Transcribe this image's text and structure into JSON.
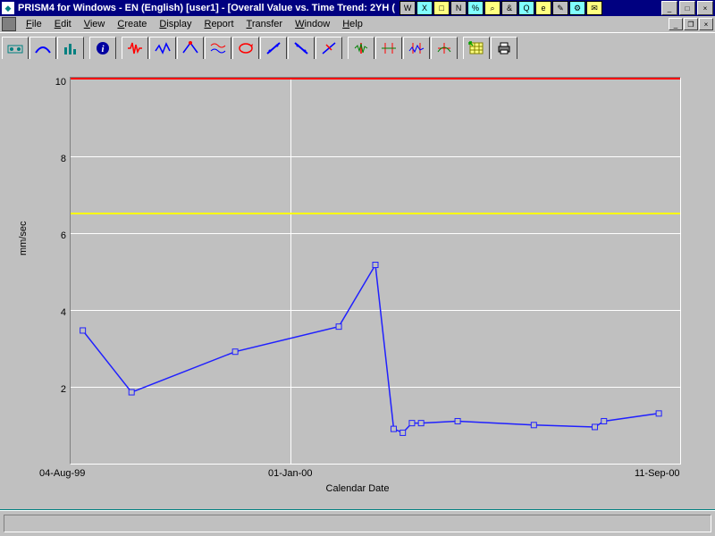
{
  "titlebar": {
    "title": "PRISM4 for Windows - EN (English) [user1] - [Overall Value vs. Time Trend: 2YH (",
    "controls": {
      "min": "_",
      "max": "□",
      "close": "×"
    }
  },
  "tray_icons": [
    "W",
    "X",
    "□",
    "N",
    "%",
    "⌕",
    "&",
    "Q",
    "e",
    "✎",
    "⚙",
    "✉"
  ],
  "menu": {
    "items": [
      "File",
      "Edit",
      "View",
      "Create",
      "Display",
      "Report",
      "Transfer",
      "Window",
      "Help"
    ]
  },
  "toolbar": {
    "items": [
      "machine",
      "sweep",
      "bars",
      "info",
      "wave-red",
      "wave-blue",
      "peak",
      "dual-wave",
      "loop",
      "slash-up",
      "slash-down",
      "slash-x",
      "arrows-1",
      "arrows-2",
      "arrows-3",
      "arrows-4",
      "grid",
      "print"
    ]
  },
  "axes": {
    "ylabel": "mm/sec",
    "xlabel": "Calendar Date",
    "yticks": [
      "2",
      "4",
      "6",
      "8",
      "10"
    ],
    "xticks": {
      "left": "04-Aug-99",
      "mid": "01-Jan-00",
      "right": "11-Sep-00"
    }
  },
  "chart_data": {
    "type": "line",
    "title": "Overall Value vs. Time Trend",
    "xlabel": "Calendar Date",
    "ylabel": "mm/sec",
    "ylim": [
      0,
      10
    ],
    "x_range": [
      "04-Aug-99",
      "11-Sep-00"
    ],
    "reference_lines": [
      {
        "y": 10.0,
        "color": "#ff0000"
      },
      {
        "y": 6.5,
        "color": "#ffff00"
      }
    ],
    "series": [
      {
        "name": "Overall Value",
        "color": "#2020ff",
        "points": [
          {
            "x_frac": 0.02,
            "y": 3.45
          },
          {
            "x_frac": 0.1,
            "y": 1.85
          },
          {
            "x_frac": 0.27,
            "y": 2.9
          },
          {
            "x_frac": 0.44,
            "y": 3.55
          },
          {
            "x_frac": 0.5,
            "y": 5.15
          },
          {
            "x_frac": 0.53,
            "y": 0.9
          },
          {
            "x_frac": 0.545,
            "y": 0.8
          },
          {
            "x_frac": 0.56,
            "y": 1.05
          },
          {
            "x_frac": 0.575,
            "y": 1.05
          },
          {
            "x_frac": 0.635,
            "y": 1.1
          },
          {
            "x_frac": 0.76,
            "y": 1.0
          },
          {
            "x_frac": 0.86,
            "y": 0.95
          },
          {
            "x_frac": 0.875,
            "y": 1.1
          },
          {
            "x_frac": 0.965,
            "y": 1.3
          }
        ]
      }
    ]
  }
}
